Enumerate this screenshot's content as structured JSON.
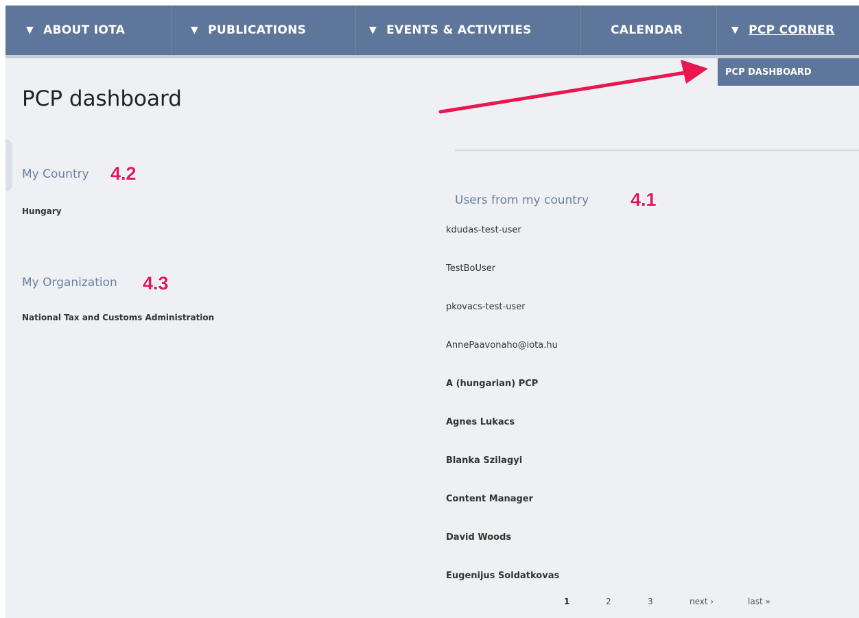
{
  "nav": {
    "items": [
      {
        "label": "ABOUT IOTA",
        "has_dropdown": true
      },
      {
        "label": "PUBLICATIONS",
        "has_dropdown": true
      },
      {
        "label": "EVENTS & ACTIVITIES",
        "has_dropdown": true
      },
      {
        "label": "CALENDAR",
        "has_dropdown": false
      },
      {
        "label": "PCP CORNER",
        "has_dropdown": true,
        "active": true
      }
    ],
    "dropdown_glyph": "▼",
    "submenu": {
      "label": "PCP DASHBOARD"
    }
  },
  "page": {
    "title": "PCP dashboard"
  },
  "my_country": {
    "heading": "My Country",
    "annotation": "4.2",
    "value": "Hungary"
  },
  "my_organization": {
    "heading": "My Organization",
    "annotation": "4.3",
    "value": "National Tax and Customs Administration"
  },
  "users": {
    "heading": "Users from my country",
    "annotation": "4.1",
    "items": [
      {
        "name": "kdudas-test-user",
        "bold": false
      },
      {
        "name": "TestBoUser",
        "bold": false
      },
      {
        "name": "pkovacs-test-user",
        "bold": false
      },
      {
        "name": "AnnePaavonaho@iota.hu",
        "bold": false
      },
      {
        "name": "A (hungarian) PCP",
        "bold": true
      },
      {
        "name": "Agnes Lukacs",
        "bold": true
      },
      {
        "name": "Blanka Szilagyi",
        "bold": true
      },
      {
        "name": "Content Manager",
        "bold": true
      },
      {
        "name": "David Woods",
        "bold": true
      },
      {
        "name": "Eugenijus Soldatkovas",
        "bold": true
      }
    ]
  },
  "pager": {
    "pages": [
      "1",
      "2",
      "3"
    ],
    "current": "1",
    "next": "next ›",
    "last": "last »"
  },
  "colors": {
    "nav": "#5e7699",
    "heading": "#6a7fa1",
    "annotation": "#e3165b",
    "arrow": "#e8174f",
    "background": "#eef0f3"
  }
}
